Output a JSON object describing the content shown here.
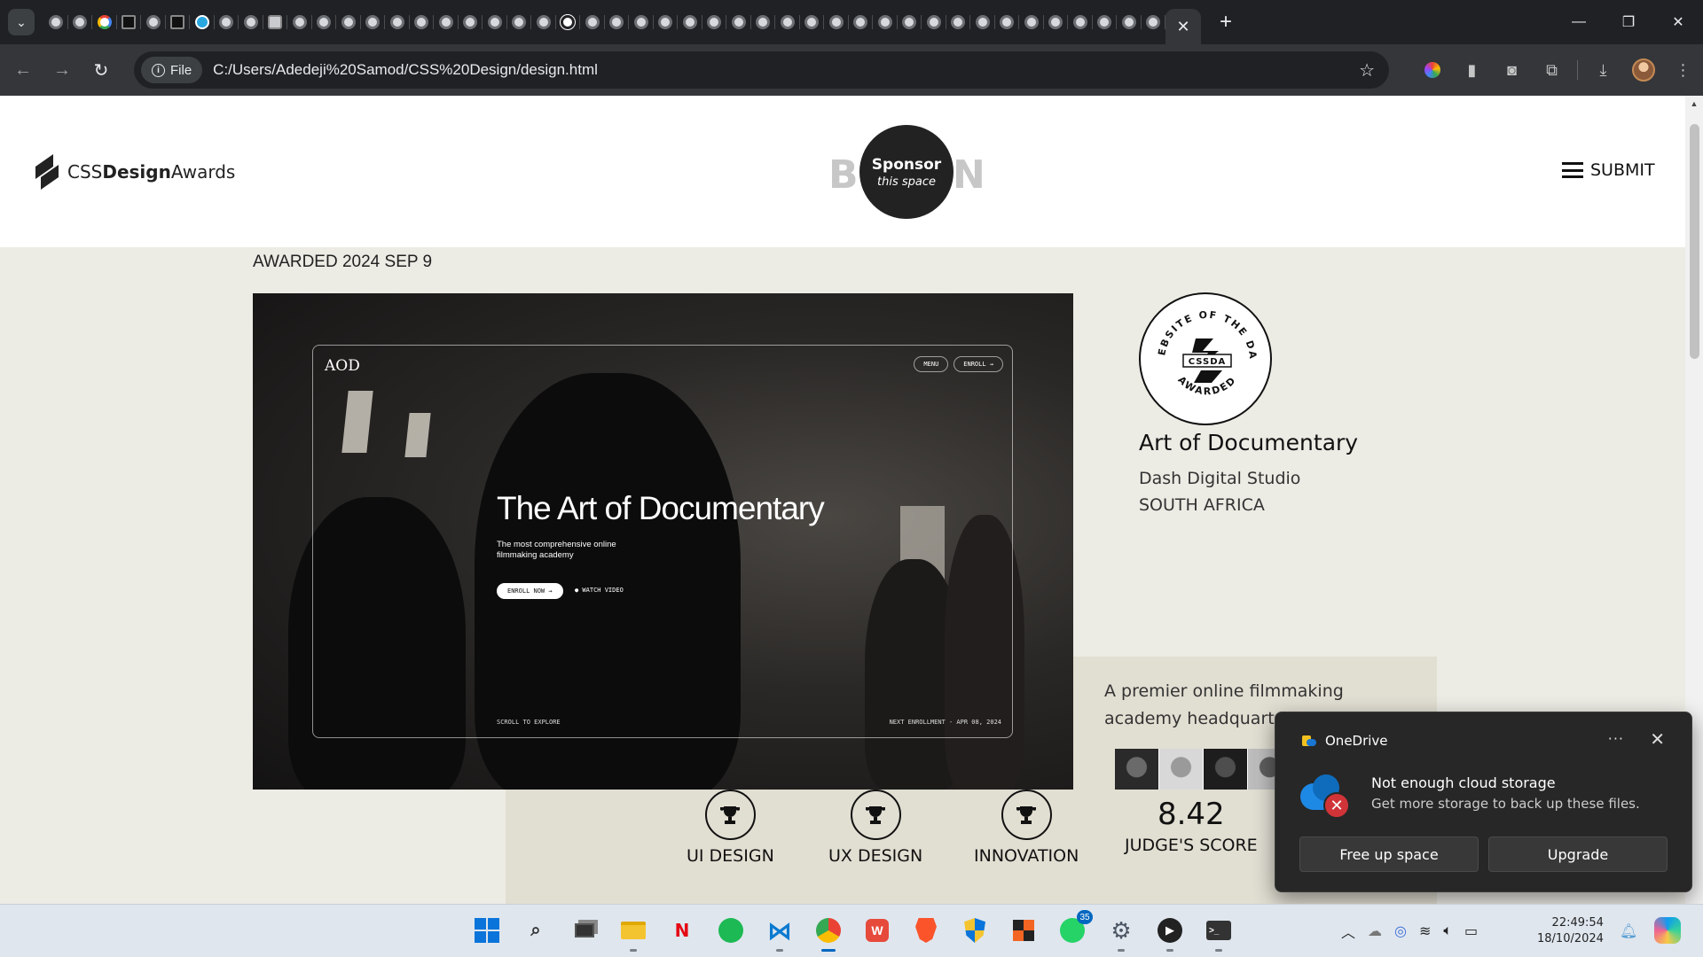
{
  "browser": {
    "tab_count_shown": 60,
    "url_chip": "File",
    "url": "C:/Users/Adedeji%20Samod/CSS%20Design/design.html"
  },
  "site": {
    "logo_prefix": "CSS",
    "logo_bold": "Design",
    "logo_suffix": "Awards",
    "sponsor_left_letter": "B",
    "sponsor_right_letter": "N",
    "sponsor_title": "Sponsor",
    "sponsor_sub": "this space",
    "submit_label": "SUBMIT"
  },
  "award": {
    "date_text": "AWARDED 2024 SEP 9",
    "badge_top_text": "WEBSITE OF THE DAY",
    "badge_center": "CSSDA",
    "badge_bottom_text": "AWARDED",
    "site_title": "Art of Documentary",
    "studio": "Dash Digital Studio",
    "country": "SOUTH AFRICA",
    "description": "A premier online filmmaking academy headquarter"
  },
  "hero": {
    "logo": "AOD",
    "menu_pill": "MENU",
    "enroll_pill": "ENROLL →",
    "title": "The Art of Documentary",
    "subtitle": "The most comprehensive online filmmaking academy",
    "cta": "ENROLL NOW →",
    "watch": "● WATCH VIDEO",
    "scroll": "SCROLL TO EXPLORE",
    "next_enrollment": "NEXT ENROLLMENT - APR 08, 2024"
  },
  "scores": [
    {
      "label": "UI DESIGN"
    },
    {
      "label": "UX DESIGN"
    },
    {
      "label": "INNOVATION"
    }
  ],
  "judge_score": {
    "value": "8.42",
    "label": "JUDGE'S SCORE"
  },
  "toast": {
    "app": "OneDrive",
    "more": "···",
    "title": "Not enough cloud storage",
    "body": "Get more storage to back up these files.",
    "primary_button": "Free up space",
    "secondary_button": "Upgrade"
  },
  "taskbar": {
    "whatsapp_badge": "35",
    "time": "22:49:54",
    "date": "18/10/2024"
  }
}
